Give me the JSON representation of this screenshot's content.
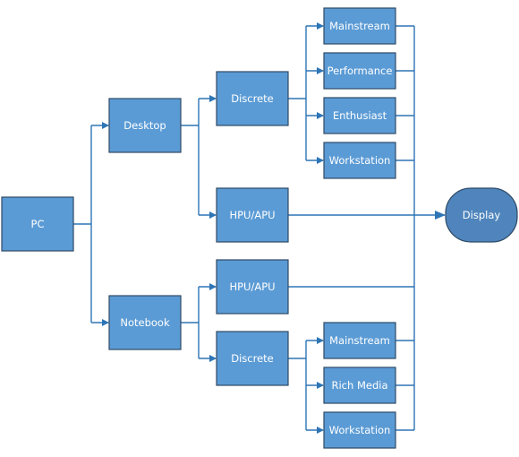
{
  "diagram": {
    "colors": {
      "box_fill": "#5b9bd5",
      "terminal_fill": "#4f85bc",
      "connector": "#2e75b6"
    },
    "root": "PC",
    "desktop": {
      "label": "Desktop",
      "discrete": {
        "label": "Discrete",
        "children": [
          "Mainstream",
          "Performance",
          "Enthusiast",
          "Workstation"
        ]
      },
      "hpu_apu": "HPU/APU"
    },
    "notebook": {
      "label": "Notebook",
      "hpu_apu": "HPU/APU",
      "discrete": {
        "label": "Discrete",
        "children": [
          "Mainstream",
          "Rich Media",
          "Workstation"
        ]
      }
    },
    "output": "Display"
  }
}
